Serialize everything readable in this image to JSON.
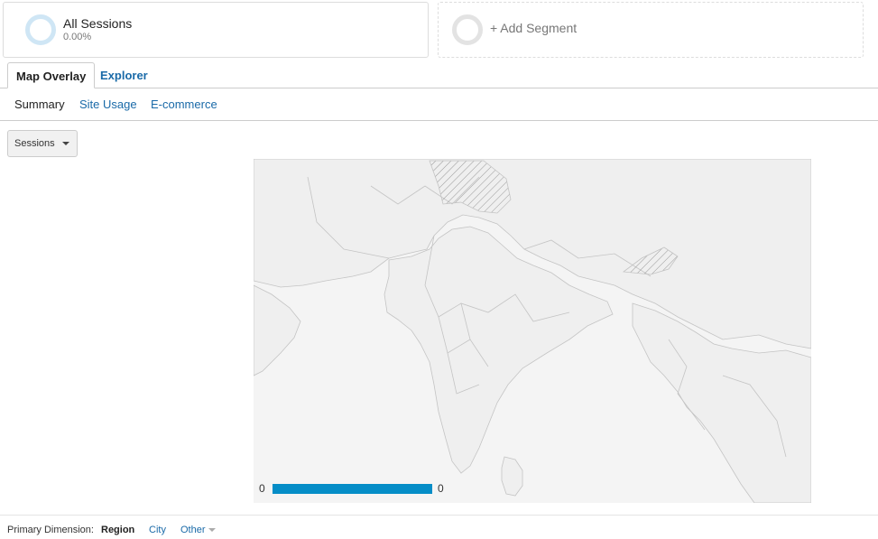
{
  "segments": {
    "primary": {
      "title": "All Sessions",
      "percent": "0.00%"
    },
    "add": {
      "label": "+ Add Segment"
    }
  },
  "tabs": [
    {
      "label": "Map Overlay",
      "active": true
    },
    {
      "label": "Explorer",
      "active": false
    }
  ],
  "subtabs": [
    {
      "label": "Summary",
      "active": true
    },
    {
      "label": "Site Usage",
      "active": false
    },
    {
      "label": "E-commerce",
      "active": false
    }
  ],
  "metric_select": {
    "value": "Sessions"
  },
  "map": {
    "legend": {
      "min": "0",
      "max": "0",
      "color": "#058dc7"
    }
  },
  "primary_dimension": {
    "label": "Primary Dimension:",
    "options": [
      {
        "label": "Region",
        "active": true
      },
      {
        "label": "City",
        "active": false
      },
      {
        "label": "Other",
        "active": false
      }
    ]
  }
}
